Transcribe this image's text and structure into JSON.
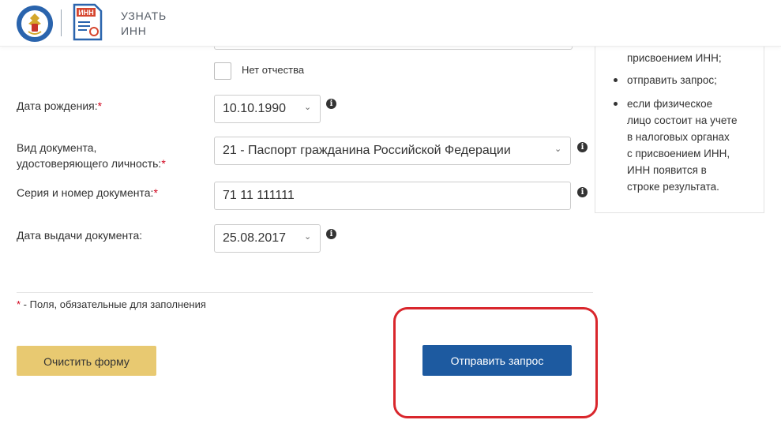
{
  "header": {
    "title": "УЗНАТЬ ИНН",
    "inn_badge": "ИНН",
    "emblem_icon": "fns-emblem-icon",
    "app_icon": "inn-document-icon"
  },
  "form": {
    "no_patronymic_label": "Нет отчества",
    "birth_date": {
      "label": "Дата рождения:",
      "required_mark": "*",
      "value": "10.10.1990"
    },
    "doc_type": {
      "label_line1": "Вид документа,",
      "label_line2": "удостоверяющего личность:",
      "required_mark": "*",
      "value": "21 - Паспорт гражданина Российской Федерации"
    },
    "doc_number": {
      "label": "Серия и номер документа:",
      "required_mark": "*",
      "value": "71 11 111111"
    },
    "issue_date": {
      "label": "Дата выдачи документа:",
      "value": "25.08.2017"
    },
    "required_note_mark": "*",
    "required_note": " - Поля, обязательные для заполнения",
    "clear_button": "Очистить форму",
    "submit_button": "Отправить запрос"
  },
  "side_panel": {
    "line_cut": "присвоением ИНН;",
    "item_send": "отправить запрос;",
    "item_result": [
      "если физическое",
      "лицо состоит на учете",
      "в налоговых органах",
      "с присвоением ИНН,",
      "ИНН появится в",
      "строке результата."
    ]
  },
  "colors": {
    "submit": "#1d5aa0",
    "clear": "#e8c971",
    "required": "#d0021b",
    "highlight": "#d9262c"
  }
}
